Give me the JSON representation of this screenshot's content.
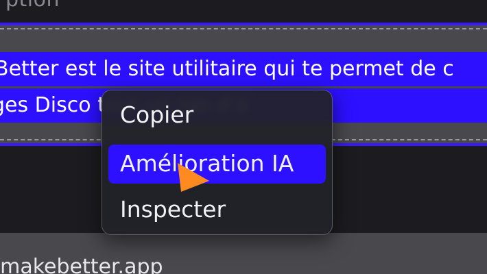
{
  "field": {
    "label": "ption",
    "description_line1": "Better est le site utilitaire qui te permet de c",
    "description_line2": "ges Disco                              tout un tas d’a",
    "url_value": "/makebetter.app"
  },
  "context_menu": {
    "items": [
      {
        "label": "Copier"
      },
      {
        "label": "Amélioration IA"
      },
      {
        "label": "Inspecter"
      }
    ],
    "highlighted_item": "Amélioration IA"
  },
  "colors": {
    "selection": "#2c10ff",
    "cursor": "#ff8a1f",
    "menu_bg": "#222228"
  }
}
